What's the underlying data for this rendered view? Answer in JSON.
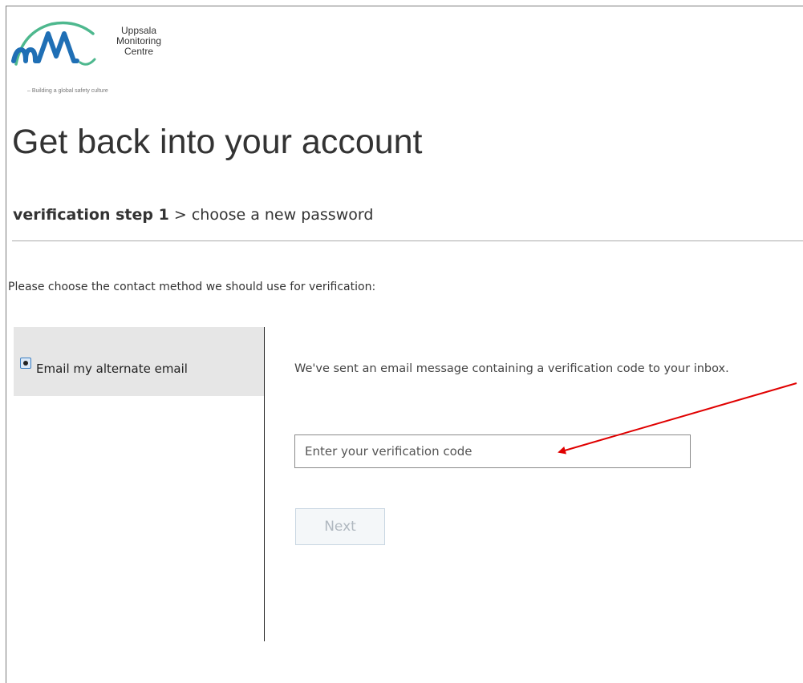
{
  "brand": {
    "name_lines": [
      "Uppsala",
      "Monitoring",
      "Centre"
    ],
    "tagline": "– Building a global safety culture",
    "colors": {
      "green": "#4eb88e",
      "blue": "#1f6fb5"
    }
  },
  "page": {
    "title": "Get back into your account"
  },
  "steps": {
    "current": "verification step 1",
    "separator": ">",
    "next": "choose a new password"
  },
  "instructions": "Please choose the contact method we should use for verification:",
  "methods": {
    "selected_label": "Email my alternate email"
  },
  "verification": {
    "message": "We've sent an email message containing a verification code to your inbox.",
    "code_placeholder": "Enter your verification code",
    "code_value": "",
    "next_label": "Next"
  },
  "annotation": {
    "color": "#e00000",
    "icon": "red-arrow-icon"
  }
}
